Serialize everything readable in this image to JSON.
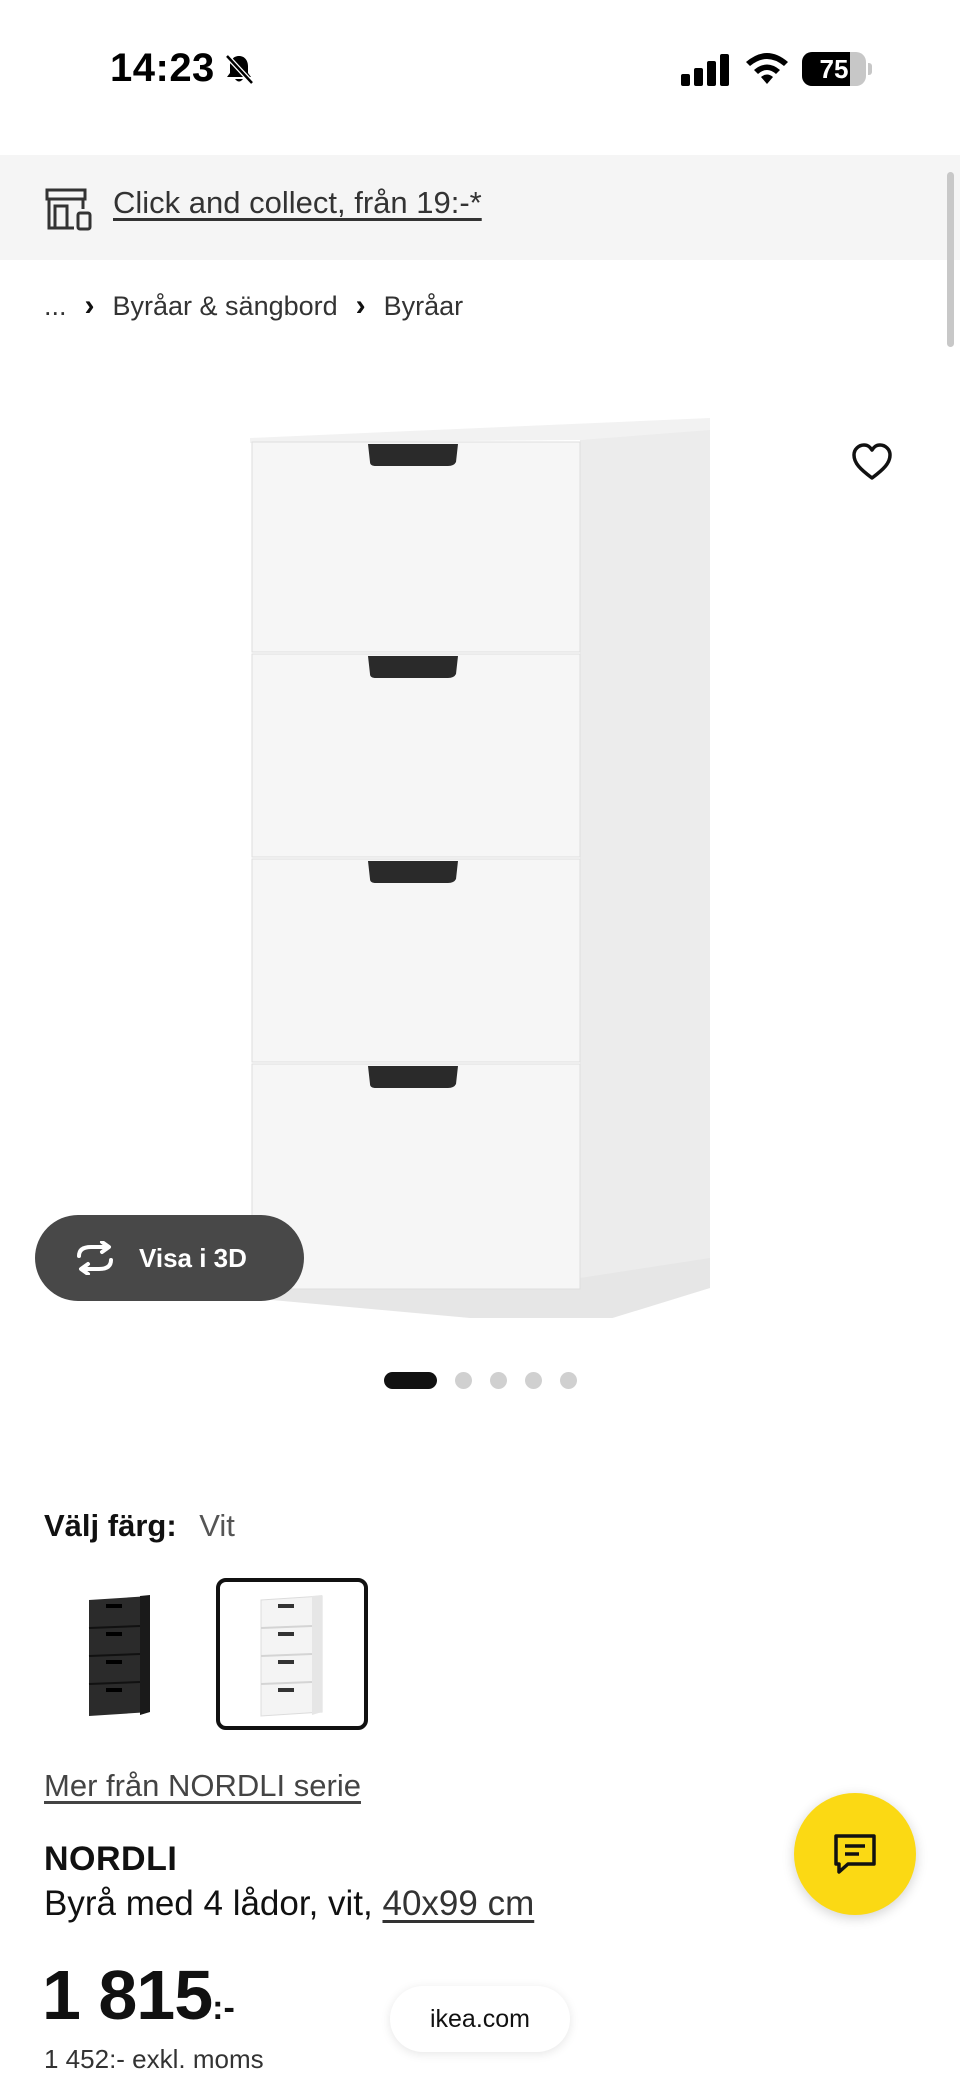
{
  "status_bar": {
    "time": "14:23",
    "battery": "75",
    "battery_level": 0.75,
    "icons": [
      "bell-slash-icon",
      "cellular-signal-icon",
      "wifi-icon",
      "battery-icon"
    ]
  },
  "collect_banner": {
    "icon": "store-icon",
    "text": "Click and collect, från 19:-*"
  },
  "breadcrumb": {
    "items": [
      "...",
      "Byråar & sängbord",
      "Byråar"
    ]
  },
  "hero": {
    "view3d_label": "Visa i 3D",
    "image_count": 5,
    "active_image": 1
  },
  "color_picker": {
    "label": "Välj färg:",
    "value": "Vit",
    "options": [
      "black",
      "white"
    ],
    "selected": "white"
  },
  "series_link": "Mer från NORDLI serie",
  "product": {
    "name": "NORDLI",
    "description": "Byrå med 4 lådor, vit, ",
    "size": "40x99 cm",
    "price": "1 815",
    "price_suffix": ":-",
    "price_excl": "1 452:- exkl. moms"
  },
  "footer": {
    "domain": "ikea.com"
  },
  "colors": {
    "chat_button": "#fbd914",
    "view3d_button": "#484848",
    "banner_bg": "#f5f5f5"
  }
}
